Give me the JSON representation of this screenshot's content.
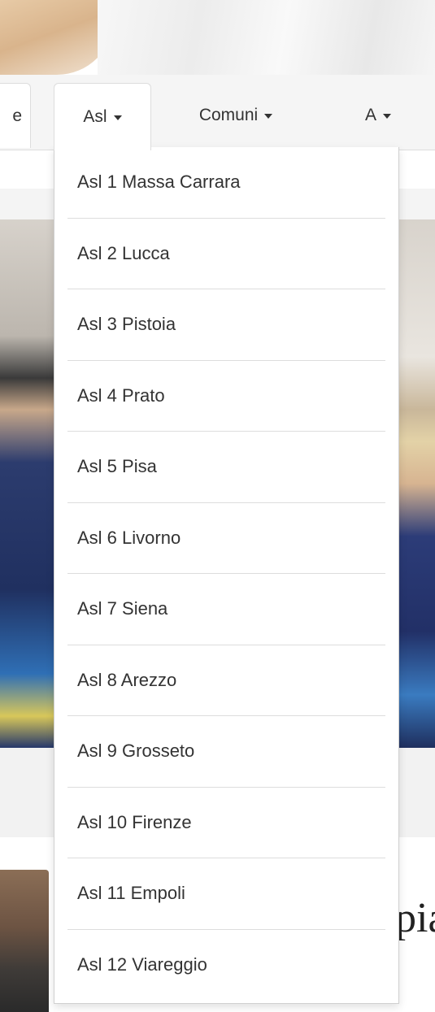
{
  "nav": {
    "prev_tab_label": "e",
    "tabs": [
      {
        "id": "asl",
        "label": "Asl"
      },
      {
        "id": "comuni",
        "label": "Comuni"
      },
      {
        "id": "a",
        "label": "A"
      }
    ]
  },
  "dropdown": {
    "items": [
      "Asl 1 Massa Carrara",
      "Asl 2 Lucca",
      "Asl 3 Pistoia",
      "Asl 4 Prato",
      "Asl 5 Pisa",
      "Asl 6 Livorno",
      "Asl 7 Siena",
      "Asl 8 Arezzo",
      "Asl 9 Grosseto",
      "Asl 10 Firenze",
      "Asl 11 Empoli",
      "Asl 12 Viareggio"
    ]
  },
  "content": {
    "peek_text": "pia"
  }
}
